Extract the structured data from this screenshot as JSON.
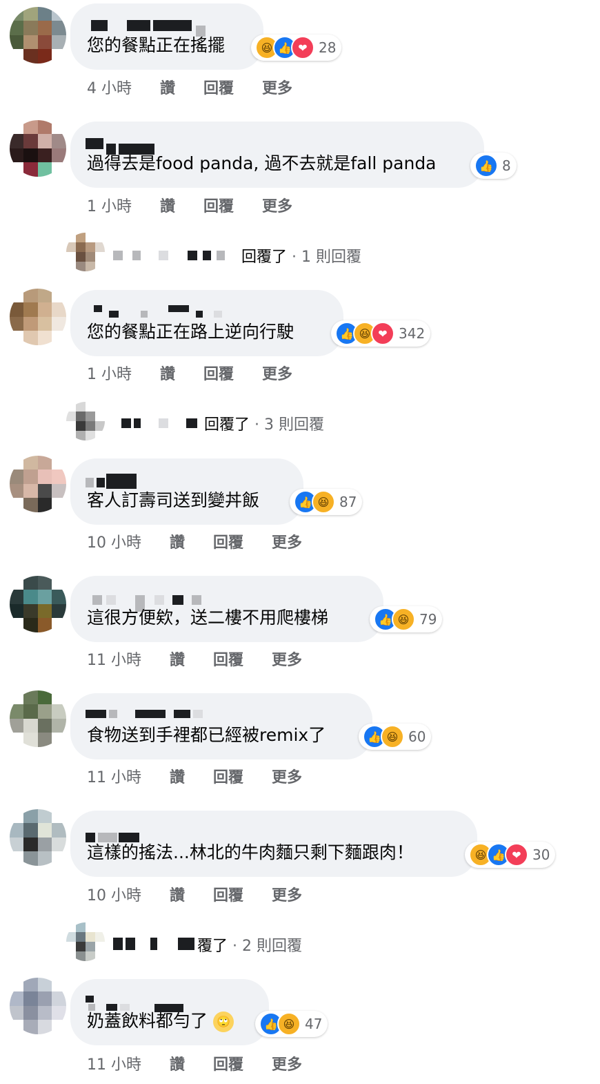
{
  "comments": [
    {
      "text": "您的餐點正在搖擺",
      "reactions": [
        "haha",
        "like",
        "love"
      ],
      "count": "28",
      "time": "4 小時"
    },
    {
      "text": "過得去是food panda, 過不去就是fall panda",
      "reactions": [
        "like"
      ],
      "count": "8",
      "time": "1 小時"
    },
    {
      "text": "您的餐點正在路上逆向行駛",
      "reactions": [
        "like",
        "haha",
        "love"
      ],
      "count": "342",
      "time": "1 小時"
    },
    {
      "text": "客人訂壽司送到變丼飯",
      "reactions": [
        "like",
        "haha"
      ],
      "count": "87",
      "time": "10 小時"
    },
    {
      "text": "這很方便欸，送二樓不用爬樓梯",
      "reactions": [
        "like",
        "haha"
      ],
      "count": "79",
      "time": "11 小時"
    },
    {
      "text": "食物送到手裡都已經被remix了",
      "reactions": [
        "like",
        "haha"
      ],
      "count": "60",
      "time": "11 小時"
    },
    {
      "text": "這樣的搖法...林北的牛肉麵只剩下麵跟肉！",
      "reactions": [
        "haha",
        "like",
        "love"
      ],
      "count": "30",
      "time": "10 小時"
    },
    {
      "text": "奶蓋飲料都勻了",
      "reactions": [
        "like",
        "haha"
      ],
      "count": "47",
      "time": "11 小時"
    }
  ],
  "actions": {
    "like": "讚",
    "reply": "回覆",
    "more": "更多"
  },
  "replies": [
    {
      "label": "回覆了",
      "count": "1 則回覆"
    },
    {
      "label": "回覆了",
      "count": "3 則回覆"
    },
    {
      "label": "覆了",
      "count": "2 則回覆"
    }
  ],
  "reaction_icons": {
    "like": "👍",
    "haha": "😆",
    "love": "❤"
  },
  "inline_emoji": "🙄",
  "colors": {
    "bubble": "#f0f2f5",
    "like": "#1877f2",
    "haha": "#f7b125",
    "love": "#f33e58",
    "meta": "#65676b"
  }
}
